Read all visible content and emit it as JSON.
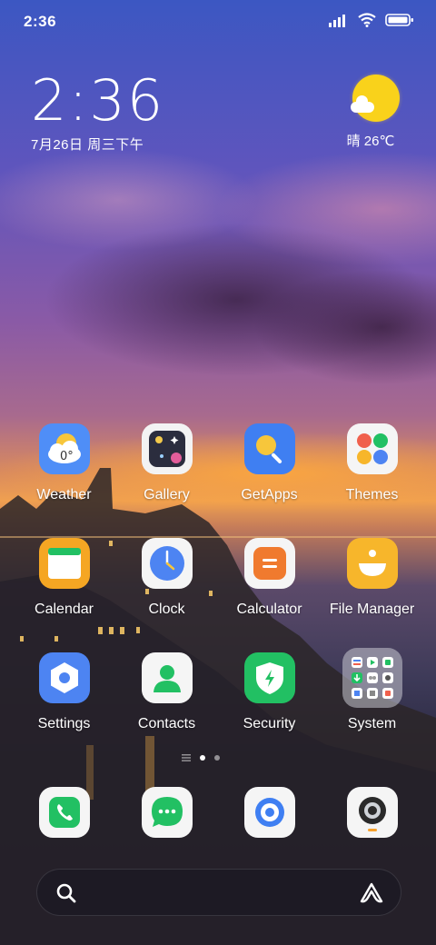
{
  "status_bar": {
    "time": "2:36",
    "icons": [
      "signal-icon",
      "wifi-icon",
      "battery-icon"
    ]
  },
  "clock_widget": {
    "time": "2:36",
    "date": "7月26日 周三下午"
  },
  "weather_widget": {
    "icon": "sun-cloud-icon",
    "text": "晴 26℃"
  },
  "app_rows": [
    [
      {
        "label": "Weather",
        "icon": "weather-icon",
        "color": "#4f8ef7"
      },
      {
        "label": "Gallery",
        "icon": "gallery-icon",
        "color": "#2a2a3a"
      },
      {
        "label": "GetApps",
        "icon": "getapps-icon",
        "color": "#3f7ff2"
      },
      {
        "label": "Themes",
        "icon": "themes-icon",
        "color": "#f5f5f5"
      }
    ],
    [
      {
        "label": "Calendar",
        "icon": "calendar-icon",
        "color": "#f5a623"
      },
      {
        "label": "Clock",
        "icon": "clock-icon",
        "color": "#f5f5f5"
      },
      {
        "label": "Calculator",
        "icon": "calculator-icon",
        "color": "#f07a2e"
      },
      {
        "label": "File Manager",
        "icon": "file-manager-icon",
        "color": "#f7b62b"
      }
    ],
    [
      {
        "label": "Settings",
        "icon": "settings-icon",
        "color": "#4d84f2"
      },
      {
        "label": "Contacts",
        "icon": "contacts-icon",
        "color": "#f5f5f5"
      },
      {
        "label": "Security",
        "icon": "security-icon",
        "color": "#22c063"
      },
      {
        "label": "System",
        "icon": "folder-icon",
        "color": "#9a9aa2"
      }
    ]
  ],
  "page_indicator": {
    "pages": 2,
    "active": 1
  },
  "dock": [
    {
      "icon": "phone-icon",
      "color": "#22c063"
    },
    {
      "icon": "messaging-icon",
      "color": "#22c063"
    },
    {
      "icon": "browser-icon",
      "color": "#3f7ff2"
    },
    {
      "icon": "camera-icon",
      "color": "#2a2a2a"
    }
  ],
  "search_bar": {
    "left_icon": "search-icon",
    "right_icon": "assistant-icon"
  }
}
